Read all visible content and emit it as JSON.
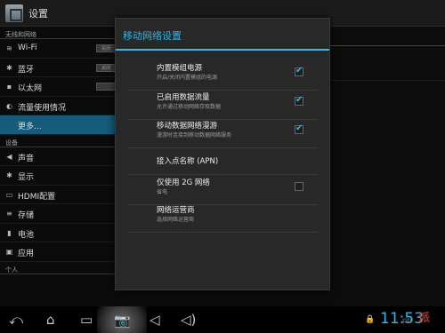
{
  "topbar": {
    "title": "设置"
  },
  "settings": {
    "section_wireless": "无线和网络",
    "wireless": [
      {
        "icon": "wifi-icon",
        "glyph": "≋",
        "label": "Wi-Fi",
        "toggle": "关闭"
      },
      {
        "icon": "bluetooth-icon",
        "glyph": "✱",
        "label": "蓝牙",
        "toggle": "关闭"
      },
      {
        "icon": "ethernet-icon",
        "glyph": "▪",
        "label": "以太网",
        "toggle": ""
      },
      {
        "icon": "data-usage-icon",
        "glyph": "◐",
        "label": "流量使用情况"
      },
      {
        "icon": "",
        "glyph": "",
        "label": "更多..."
      }
    ],
    "section_device": "设备",
    "device": [
      {
        "icon": "sound-icon",
        "glyph": "◀",
        "label": "声音"
      },
      {
        "icon": "display-icon",
        "glyph": "✱",
        "label": "显示"
      },
      {
        "icon": "hdmi-icon",
        "glyph": "▭",
        "label": "HDMI配置"
      },
      {
        "icon": "storage-icon",
        "glyph": "≡",
        "label": "存储"
      },
      {
        "icon": "battery-icon",
        "glyph": "▮",
        "label": "电池"
      },
      {
        "icon": "apps-icon",
        "glyph": "▣",
        "label": "应用"
      }
    ],
    "section_personal": "个人"
  },
  "dialog": {
    "title": "移动网络设置",
    "items": [
      {
        "title": "内置模组电源",
        "summary": "开启/关闭内置模组的电源",
        "checkbox": true,
        "checked": true
      },
      {
        "title": "已启用数据流量",
        "summary": "允许通过移动网络存取数据",
        "checkbox": true,
        "checked": true
      },
      {
        "title": "移动数据网络漫游",
        "summary": "漫游时连接到移动数据网络服务",
        "checkbox": true,
        "checked": true
      },
      {
        "title": "接入点名称 (APN)",
        "summary": "",
        "checkbox": false,
        "checked": false
      },
      {
        "title": "仅使用 2G 网络",
        "summary": "省电",
        "checkbox": true,
        "checked": false
      },
      {
        "title": "网络运营商",
        "summary": "选择网络运营商",
        "checkbox": false,
        "checked": false
      }
    ]
  },
  "navbar": {
    "back": "⤺",
    "home": "⌂",
    "recent": "▭",
    "camera": "📷",
    "vol_down": "◁",
    "vol_up": "◁)",
    "clock": "11:53",
    "lock": "🔒"
  },
  "watermark": {
    "text": "派",
    "sub": "pb"
  },
  "colors": {
    "accent": "#33b5e5",
    "selected_row": "#155b7a",
    "dialog_bg": "#282828"
  }
}
